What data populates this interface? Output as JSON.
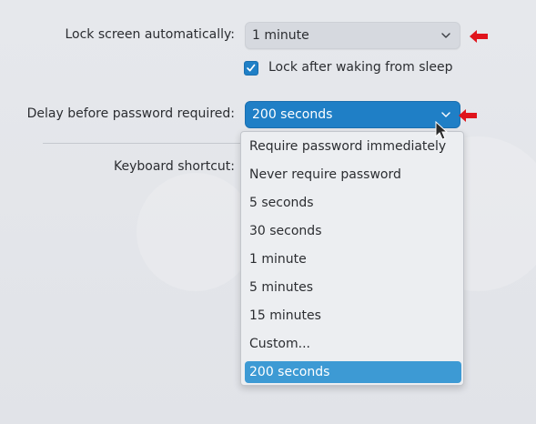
{
  "settings": {
    "lock_screen_label": "Lock screen automatically:",
    "lock_screen_value": "1 minute",
    "lock_after_sleep_label": "Lock after waking from sleep",
    "lock_after_sleep_checked": true,
    "delay_label": "Delay before password required:",
    "delay_value": "200 seconds",
    "keyboard_shortcut_label": "Keyboard shortcut:"
  },
  "dropdown": {
    "options": [
      "Require password immediately",
      "Never require password",
      "5 seconds",
      "30 seconds",
      "1 minute",
      "5 minutes",
      "15 minutes",
      "Custom...",
      "200 seconds"
    ],
    "selected": "200 seconds"
  },
  "icons": {
    "chevron": "chevron-down-icon",
    "check": "checkmark-icon",
    "annotation_arrow": "red-arrow-icon",
    "cursor": "mouse-pointer-icon"
  },
  "colors": {
    "accent": "#1f7fc6",
    "menu_highlight": "#3d9ad4",
    "annotation_red": "#e0141c"
  }
}
